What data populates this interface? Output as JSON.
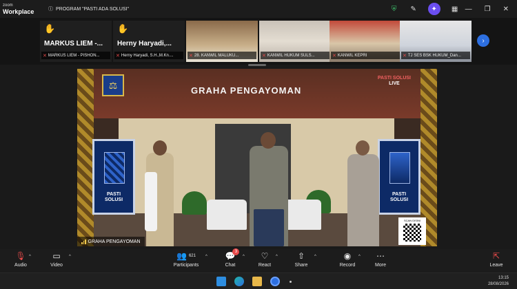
{
  "titlebar": {
    "brand_line1": "zoom",
    "brand_line2": "Workplace",
    "meeting_title": "PROGRAM \"PASTI ADA SOLUSI\""
  },
  "participants": [
    {
      "big_name": "MARKUS LIEM -...",
      "label": "MARKUS LIEM - PISHON...",
      "hand_raised": true
    },
    {
      "big_name": "Herny Haryadi,...",
      "label": "Herny Haryadi, S.H.,M.Kn....",
      "hand_raised": true
    },
    {
      "label": "28. KANWIL MALUKU..."
    },
    {
      "label": "KANWIL HUKUM SULS..."
    },
    {
      "label": "KANWIL KEPRI"
    },
    {
      "label": "TJ SES BSK HUKUM_Dan..."
    }
  ],
  "main_video": {
    "stage_title": "GRAHA PENGAYOMAN",
    "banner_text_line1": "PASTI",
    "banner_text_line2": "SOLUSI",
    "live_line1": "PASTI SOLUSI",
    "live_line2": "LIVE",
    "caption": "GRAHA PENGAYOMAN",
    "qr_caption": "SCAN DISINI"
  },
  "toolbar": {
    "audio": "Audio",
    "video": "Video",
    "participants": "Participants",
    "participants_count": "621",
    "chat": "Chat",
    "chat_badge": "3",
    "react": "React",
    "share": "Share",
    "record": "Record",
    "more": "More",
    "leave": "Leave"
  },
  "taskbar": {
    "time": "13:15",
    "date": "28/08/2026"
  },
  "colors": {
    "accent_blue": "#2d6fe0",
    "mic_off_red": "#e64a4a",
    "raised_hand": "#f2c94c",
    "spark_purple": "#6b4ef0"
  }
}
